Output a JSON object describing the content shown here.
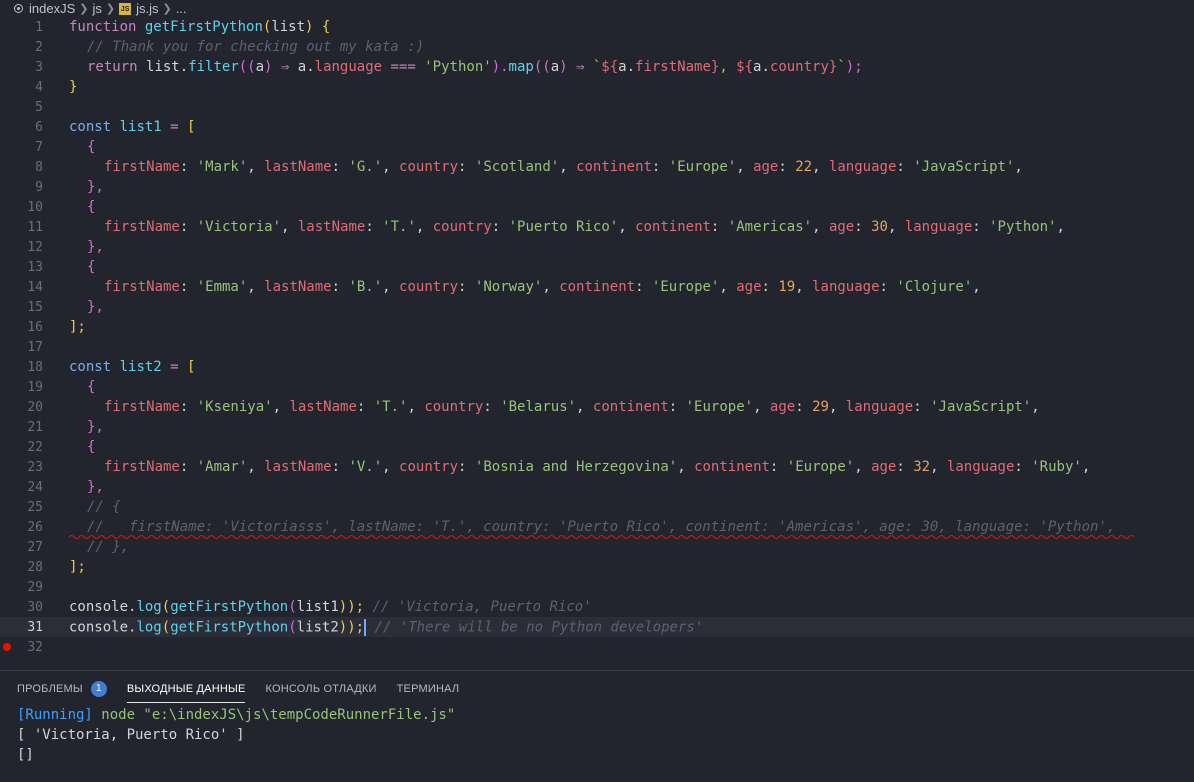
{
  "breadcrumb": [
    "indexJS",
    "js",
    "js.js",
    "..."
  ],
  "line_numbers": [
    "1",
    "2",
    "3",
    "4",
    "5",
    "6",
    "7",
    "8",
    "9",
    "10",
    "11",
    "12",
    "13",
    "14",
    "15",
    "16",
    "17",
    "18",
    "19",
    "20",
    "21",
    "22",
    "23",
    "24",
    "25",
    "26",
    "27",
    "28",
    "29",
    "30",
    "31",
    "32"
  ],
  "code": {
    "l1": [
      "function",
      "getFirstPython",
      "(",
      "list",
      ")",
      " {"
    ],
    "l2": "// Thank you for checking out my kata :)",
    "l3": [
      "return",
      "list",
      ".",
      "filter",
      "((",
      "a",
      ") ",
      "⇒",
      " a.",
      "language",
      " ",
      "===",
      " ",
      "'Python'",
      ").",
      "map",
      "((",
      "a",
      ") ",
      "⇒",
      " `",
      "${",
      "a.",
      "firstName",
      "}",
      ", ",
      "${",
      "a.",
      "country",
      "}",
      "`",
      ");"
    ],
    "l4": "}",
    "l6": [
      "const",
      "list1",
      " = ",
      "["
    ],
    "l7": "{",
    "l8": [
      "firstName",
      "'Mark'",
      "lastName",
      "'G.'",
      "country",
      "'Scotland'",
      "continent",
      "'Europe'",
      "age",
      "22",
      "language",
      "'JavaScript'"
    ],
    "l9": "},",
    "l10": "{",
    "l11": [
      "firstName",
      "'Victoria'",
      "lastName",
      "'T.'",
      "country",
      "'Puerto Rico'",
      "continent",
      "'Americas'",
      "age",
      "30",
      "language",
      "'Python'"
    ],
    "l12": "},",
    "l13": "{",
    "l14": [
      "firstName",
      "'Emma'",
      "lastName",
      "'B.'",
      "country",
      "'Norway'",
      "continent",
      "'Europe'",
      "age",
      "19",
      "language",
      "'Clojure'"
    ],
    "l15": "},",
    "l16": "];",
    "l18": [
      "const",
      "list2",
      " = ",
      "["
    ],
    "l19": "{",
    "l20": [
      "firstName",
      "'Kseniya'",
      "lastName",
      "'T.'",
      "country",
      "'Belarus'",
      "continent",
      "'Europe'",
      "age",
      "29",
      "language",
      "'JavaScript'"
    ],
    "l21": "},",
    "l22": "{",
    "l23": [
      "firstName",
      "'Amar'",
      "lastName",
      "'V.'",
      "country",
      "'Bosnia and Herzegovina'",
      "continent",
      "'Europe'",
      "age",
      "32",
      "language",
      "'Ruby'"
    ],
    "l24": "},",
    "l25": "// {",
    "l26": "//   firstName: 'Victoriasss', lastName: 'T.', country: 'Puerto Rico', continent: 'Americas', age: 30, language: 'Python',",
    "l27": "// },",
    "l28": "];",
    "l30": [
      "console",
      ".",
      "log",
      "(",
      "getFirstPython",
      "(",
      "list1",
      "));",
      " // 'Victoria, Puerto Rico'"
    ],
    "l31": [
      "console",
      ".",
      "log",
      "(",
      "getFirstPython",
      "(",
      "list2",
      "));",
      " // 'There will be no Python developers'"
    ]
  },
  "panel": {
    "tabs": [
      {
        "label": "ПРОБЛЕМЫ",
        "badge": "1"
      },
      {
        "label": "ВЫХОДНЫЕ ДАННЫЕ"
      },
      {
        "label": "КОНСОЛЬ ОТЛАДКИ"
      },
      {
        "label": "ТЕРМИНАЛ"
      }
    ],
    "output": {
      "running": "[Running]",
      "command": " node \"e:\\indexJS\\js\\tempCodeRunnerFile.js\"",
      "line2": "[ 'Victoria, Puerto Rico' ]",
      "line3": "[]"
    }
  },
  "colors": {
    "background": "#22242e",
    "keyword": "#c586c0",
    "function": "#61d2e8",
    "property": "#e06c75",
    "string": "#98c379",
    "number": "#e5a35e",
    "comment": "#5c6270",
    "accent": "#3f7fd6",
    "breakpoint": "#e51400"
  },
  "icons": [
    "target-icon",
    "chevron-right-icon",
    "js-file-icon",
    "breakpoint-icon"
  ]
}
